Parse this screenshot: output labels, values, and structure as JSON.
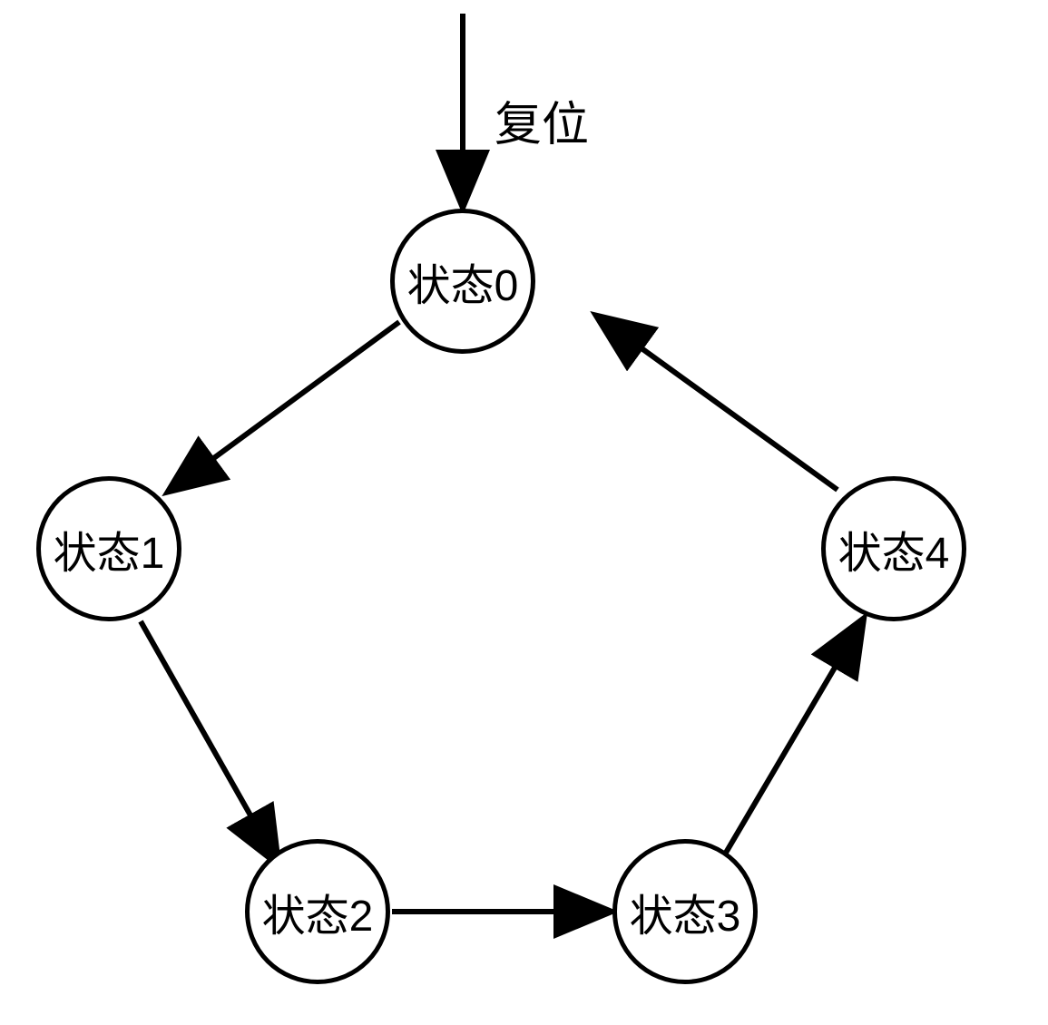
{
  "reset_label": "复位",
  "states": {
    "s0": "状态0",
    "s1": "状态1",
    "s2": "状态2",
    "s3": "状态3",
    "s4": "状态4"
  },
  "diagram": {
    "type": "state-machine",
    "initial_state": "s0",
    "transitions": [
      {
        "from": "reset",
        "to": "s0",
        "label": "复位"
      },
      {
        "from": "s0",
        "to": "s1"
      },
      {
        "from": "s1",
        "to": "s2"
      },
      {
        "from": "s2",
        "to": "s3"
      },
      {
        "from": "s3",
        "to": "s4"
      },
      {
        "from": "s4",
        "to": "s0"
      }
    ]
  }
}
